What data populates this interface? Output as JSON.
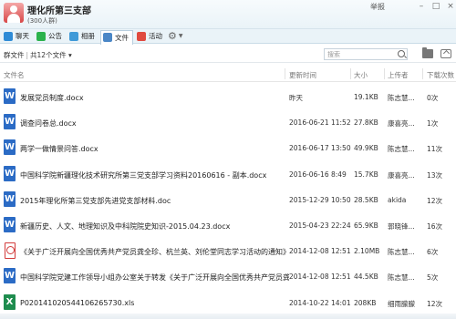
{
  "window": {
    "group_name": "理化所第三支部",
    "member_count": "(300人群)",
    "top_label": "举报"
  },
  "tabs": [
    {
      "label": "聊天",
      "icon": "chat-icon"
    },
    {
      "label": "公告",
      "icon": "notice-flag-icon"
    },
    {
      "label": "相册",
      "icon": "album-icon"
    },
    {
      "label": "文件",
      "icon": "file-icon"
    },
    {
      "label": "活动",
      "icon": "event-flag-icon"
    }
  ],
  "toolbar": {
    "breadcrumb_root": "群文件",
    "file_count": "共12个文件",
    "search_placeholder": "搜索"
  },
  "columns": {
    "name": "文件名",
    "time": "更新时间",
    "size": "大小",
    "uploader": "上传者",
    "downloads": "下载次数"
  },
  "files": [
    {
      "type": "word",
      "name": "发展党员制度.docx",
      "time": "昨天",
      "size": "19.1KB",
      "uploader": "陈志慧...",
      "downloads": "0次"
    },
    {
      "type": "word",
      "name": "调查问卷总.docx",
      "time": "2016-06-21 11:52",
      "size": "27.8KB",
      "uploader": "康喜亮...",
      "downloads": "1次"
    },
    {
      "type": "word",
      "name": "两学一做情景问答.docx",
      "time": "2016-06-17 13:50",
      "size": "49.9KB",
      "uploader": "陈志慧...",
      "downloads": "11次"
    },
    {
      "type": "word",
      "name": "中国科学院新疆理化技术研究所第三党支部学习资料20160616 - 副本.docx",
      "time": "2016-06-16 8:49",
      "size": "15.7KB",
      "uploader": "康喜亮...",
      "downloads": "13次"
    },
    {
      "type": "word",
      "name": "2015年理化所第三党支部先进党支部材料.doc",
      "time": "2015-12-29 10:50",
      "size": "28.5KB",
      "uploader": "akida",
      "downloads": "12次"
    },
    {
      "type": "word",
      "name": "新疆历史、人文、地理知识及中科院院史知识-2015.04.23.docx",
      "time": "2015-04-23 22:24",
      "size": "65.9KB",
      "uploader": "郭晓锋...",
      "downloads": "16次"
    },
    {
      "type": "pdf",
      "name": "《关于广泛开展向全国优秀共产党员龚全珍、杭兰英、刘伦堂同志学习活动的通知》.pdf",
      "time": "2014-12-08 12:51",
      "size": "2.10MB",
      "uploader": "陈志慧...",
      "downloads": "6次"
    },
    {
      "type": "word",
      "name": "中国科学院党建工作领导小组办公室关于转发《关于广泛开展向全国优秀共产党员龚全...",
      "time": "2014-12-08 12:51",
      "size": "44.5KB",
      "uploader": "陈志慧...",
      "downloads": "5次"
    },
    {
      "type": "excel",
      "name": "P020141020544106265730.xls",
      "time": "2014-10-22 14:01",
      "size": "208KB",
      "uploader": "细雨朦朦",
      "downloads": "12次"
    }
  ],
  "colors": {
    "accent": "#2b6bc5",
    "tab_bg": "#eaf3f8",
    "word": "#2b6bc5",
    "pdf": "#d23a3a",
    "excel": "#1e8c4e"
  }
}
